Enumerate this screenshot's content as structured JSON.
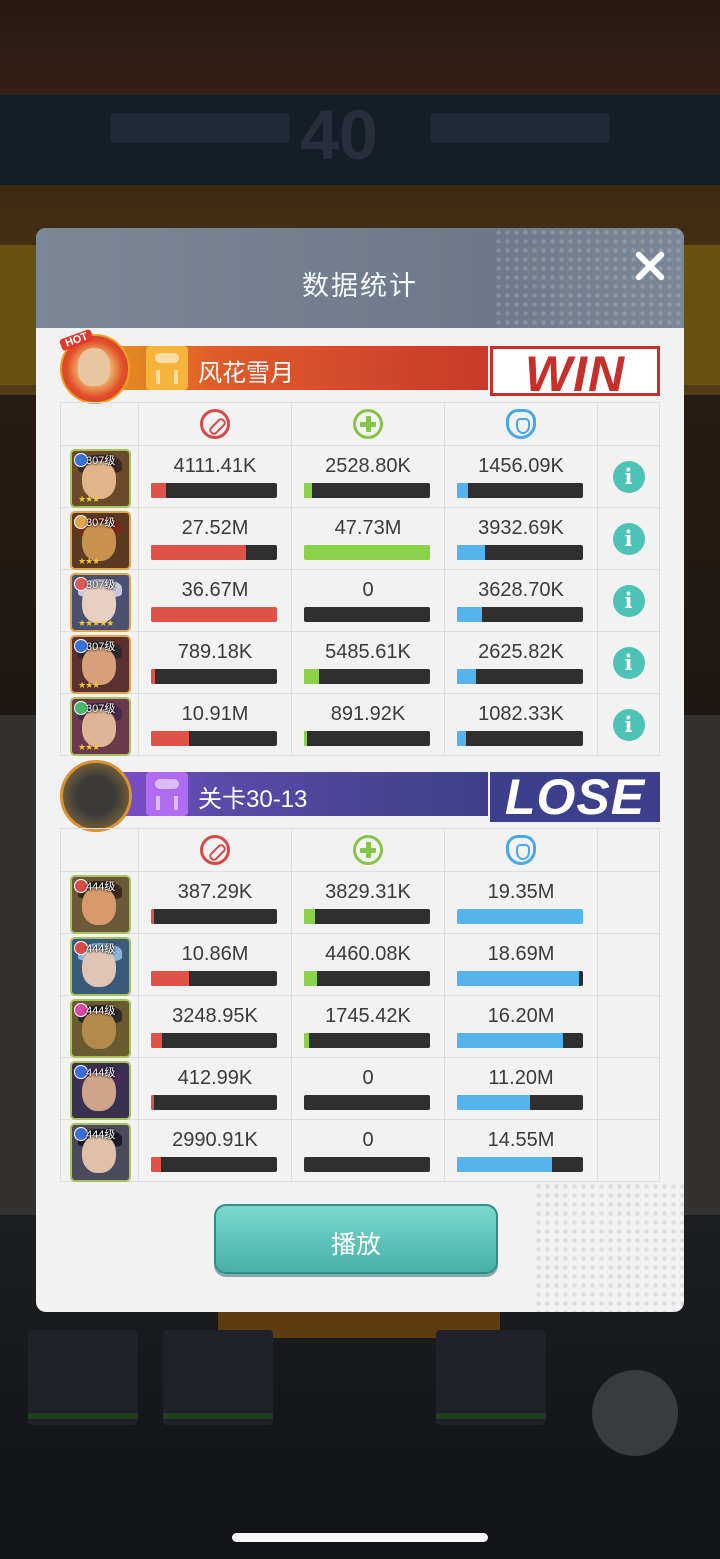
{
  "title": "数据统计",
  "winner": {
    "badge": "HOT",
    "name": "风花雪月",
    "result": "WIN",
    "heroes": [
      {
        "level": "307级",
        "gem": "#3b6fd8",
        "skin": "#e2b48a",
        "hair": "#3a2a24",
        "bg": "#6a4a2a",
        "frame": "g",
        "stars": "★★★",
        "damage": "4111.41K",
        "damage_pct": 12,
        "heal": "2528.80K",
        "heal_pct": 6,
        "defense": "1456.09K",
        "defense_pct": 9
      },
      {
        "level": "307级",
        "gem": "#e0a44a",
        "skin": "#c9924e",
        "hair": "#7a2a18",
        "bg": "#5a3a22",
        "frame": "o",
        "stars": "★★★",
        "damage": "27.52M",
        "damage_pct": 75,
        "heal": "47.73M",
        "heal_pct": 100,
        "defense": "3932.69K",
        "defense_pct": 22
      },
      {
        "level": "307级",
        "gem": "#d85a5a",
        "skin": "#e8cfc0",
        "hair": "#c8c8d8",
        "bg": "#4a5070",
        "frame": "o",
        "stars": "★★★★★",
        "damage": "36.67M",
        "damage_pct": 100,
        "heal": "0",
        "heal_pct": 0,
        "defense": "3628.70K",
        "defense_pct": 20
      },
      {
        "level": "307级",
        "gem": "#3b6fd8",
        "skin": "#d8a07a",
        "hair": "#2a2a2a",
        "bg": "#5a3030",
        "frame": "o",
        "stars": "★★★",
        "damage": "789.18K",
        "damage_pct": 3,
        "heal": "5485.61K",
        "heal_pct": 12,
        "defense": "2625.82K",
        "defense_pct": 15
      },
      {
        "level": "307级",
        "gem": "#4ab86a",
        "skin": "#e0b494",
        "hair": "#4a2a4a",
        "bg": "#6a3a4a",
        "frame": "g",
        "stars": "★★★",
        "damage": "10.91M",
        "damage_pct": 30,
        "heal": "891.92K",
        "heal_pct": 2,
        "defense": "1082.33K",
        "defense_pct": 7
      }
    ]
  },
  "loser": {
    "name": "关卡30-13",
    "result": "LOSE",
    "heroes": [
      {
        "level": "444级",
        "gem": "#d84a4a",
        "skin": "#d89a6a",
        "hair": "#3a2a1a",
        "bg": "#6a5a3a",
        "frame": "g",
        "damage": "387.29K",
        "damage_pct": 2,
        "heal": "3829.31K",
        "heal_pct": 9,
        "defense": "19.35M",
        "defense_pct": 100
      },
      {
        "level": "444级",
        "gem": "#d84a4a",
        "skin": "#e0c4b4",
        "hair": "#8ab4d8",
        "bg": "#3a5a7a",
        "frame": "g",
        "damage": "10.86M",
        "damage_pct": 30,
        "heal": "4460.08K",
        "heal_pct": 10,
        "defense": "18.69M",
        "defense_pct": 97
      },
      {
        "level": "444级",
        "gem": "#d848a8",
        "skin": "#b48a4a",
        "hair": "#2a2a2a",
        "bg": "#6a5a30",
        "frame": "g",
        "damage": "3248.95K",
        "damage_pct": 9,
        "heal": "1745.42K",
        "heal_pct": 4,
        "defense": "16.20M",
        "defense_pct": 84
      },
      {
        "level": "444级",
        "gem": "#3b6fd8",
        "skin": "#d0a48a",
        "hair": "#4a2a5a",
        "bg": "#3a3050",
        "frame": "g",
        "damage": "412.99K",
        "damage_pct": 2,
        "heal": "0",
        "heal_pct": 0,
        "defense": "11.20M",
        "defense_pct": 58
      },
      {
        "level": "444级",
        "gem": "#3b6fd8",
        "skin": "#e0c0a8",
        "hair": "#1a1a2a",
        "bg": "#4a4a5a",
        "frame": "g",
        "damage": "2990.91K",
        "damage_pct": 8,
        "heal": "0",
        "heal_pct": 0,
        "defense": "14.55M",
        "defense_pct": 75
      }
    ]
  },
  "play_label": "播放",
  "colors": {
    "damage": "#e05248",
    "heal": "#8ad24a",
    "defense": "#55b4ec",
    "info": "#4dc2b7",
    "win": "#c7302a",
    "lose": "#3b3f8c"
  }
}
